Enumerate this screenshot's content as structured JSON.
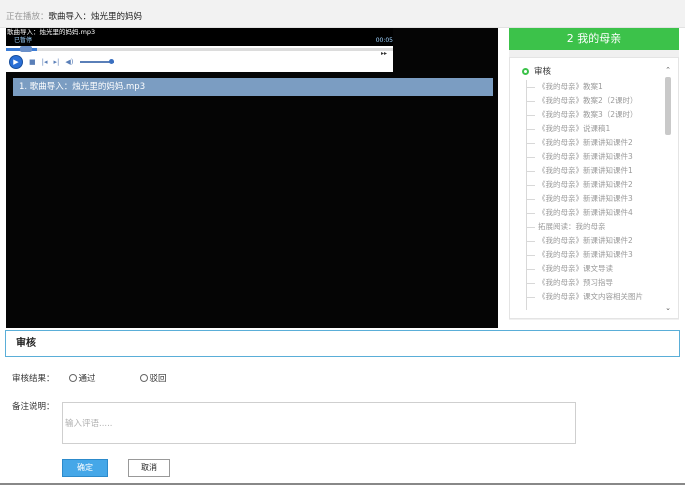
{
  "now_playing": {
    "label": "正在播放：",
    "value": "歌曲导入：烛光里的妈妈"
  },
  "player": {
    "track_title": "歌曲导入：烛光里的妈妈.mp3",
    "status": "已暂停",
    "time": "00:05",
    "seek_progress": 0.08,
    "volume_level": 1.0,
    "icons": {
      "play": "play-icon",
      "stop": "stop-icon",
      "prev": "previous-icon",
      "next": "next-icon",
      "volume": "volume-icon"
    }
  },
  "playlist": [
    "1. 歌曲导入：烛光里的妈妈.mp3"
  ],
  "sidebar": {
    "title": "2 我的母亲",
    "root": "审核",
    "items": [
      "《我的母亲》教案1",
      "《我的母亲》教案2（2课时）",
      "《我的母亲》教案3（2课时）",
      "《我的母亲》说课稿1",
      "《我的母亲》新课讲知课件2",
      "《我的母亲》新课讲知课件3",
      "《我的母亲》新课讲知课件1",
      "《我的母亲》新课讲知课件2",
      "《我的母亲》新课讲知课件3",
      "《我的母亲》新课讲知课件4",
      "拓展阅读：我的母亲",
      "《我的母亲》新课讲知课件2",
      "《我的母亲》新课讲知课件3",
      "《我的母亲》课文导读",
      "《我的母亲》预习指导",
      "《我的母亲》课文内容相关图片"
    ]
  },
  "review": {
    "title": "审核",
    "result_label": "审核结果：",
    "options": [
      "通过",
      "驳回"
    ],
    "remark_label": "备注说明：",
    "remark_placeholder": "输入评语.....",
    "confirm": "确定",
    "cancel": "取消"
  },
  "colors": {
    "accent_green": "#3cc24a",
    "playlist_highlight": "#7b9dc2",
    "review_border": "#5aaed8",
    "confirm_button": "#45a7e8"
  }
}
